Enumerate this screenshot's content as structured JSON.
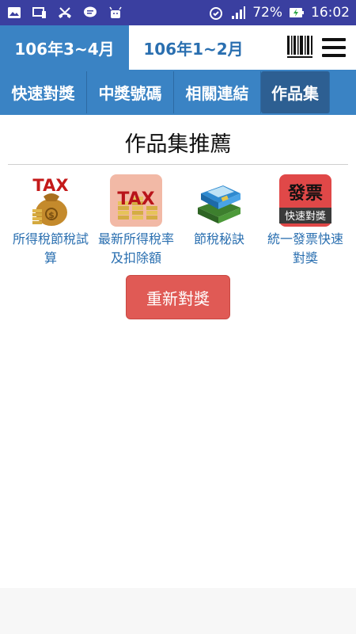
{
  "status_bar": {
    "battery_percent": "72%",
    "time": "16:02",
    "left_icons": [
      "image-icon",
      "cast-icon",
      "missed-call-icon",
      "message-icon",
      "android-icon"
    ],
    "right_icons": [
      "alarm-icon",
      "signal-icon",
      "battery-charging-icon"
    ],
    "background": "#3a3fa0"
  },
  "period_tabs": [
    {
      "label": "106年3~4月",
      "active": true
    },
    {
      "label": "106年1~2月",
      "active": false
    }
  ],
  "nav": {
    "items": [
      {
        "label": "快速對獎",
        "active": false
      },
      {
        "label": "中獎號碼",
        "active": false
      },
      {
        "label": "相關連結",
        "active": false
      },
      {
        "label": "作品集",
        "active": true
      }
    ],
    "color": "#3a83c4"
  },
  "page": {
    "title": "作品集推薦"
  },
  "apps": [
    {
      "label": "所得稅節稅試算",
      "icon": "tax-moneybag-icon",
      "icon_text": "TAX"
    },
    {
      "label": "最新所得稅率及扣除額",
      "icon": "tax-coins-icon",
      "icon_text": "TAX"
    },
    {
      "label": "節稅秘訣",
      "icon": "books-icon",
      "icon_text": ""
    },
    {
      "label": "統一發票快速對獎",
      "icon": "invoice-icon",
      "icon_text": "發票",
      "icon_subtext": "快速對獎"
    }
  ],
  "restart_button": {
    "label": "重新對獎",
    "color": "#e05a55"
  }
}
